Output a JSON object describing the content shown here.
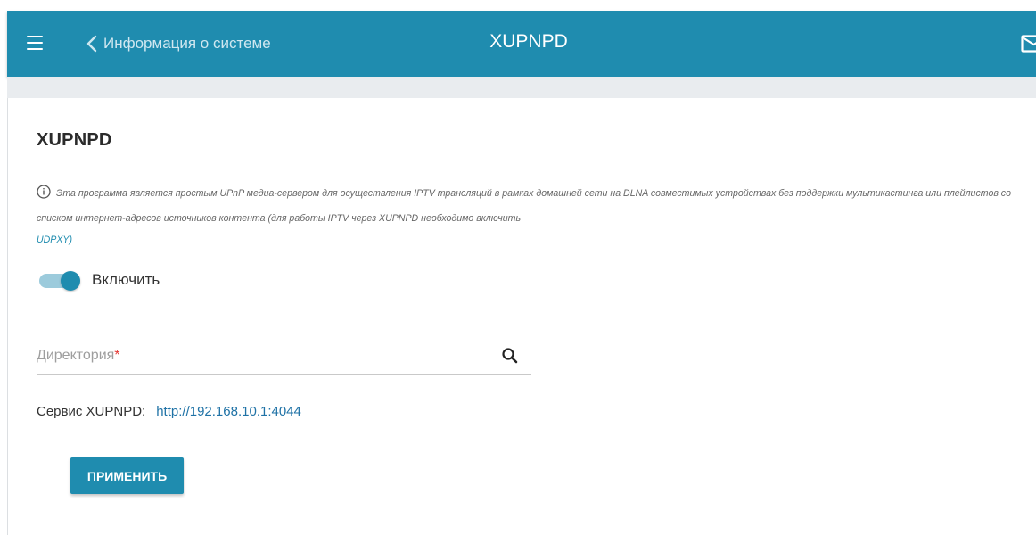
{
  "header": {
    "back_label": "Информация о системе",
    "title": "XUPNPD",
    "bg_color": "#1f8caf"
  },
  "page": {
    "title": "XUPNPD",
    "info_text": "Эта программа является простым UPnP медиа-сервером для осуществления IPTV трансляций в рамках домашней сети на DLNA совместимых устройствах без поддержки мультикастинга или плейлистов со списком интернет-адресов источников контента (для работы IPTV через XUPNPD необходимо включить",
    "info_link": "UDPXY)",
    "enable_label": "Включить",
    "enable_state": true,
    "directory_placeholder": "Директория",
    "required_mark": "*",
    "service_label": "Сервис XUPNPD:",
    "service_url": "http://192.168.10.1:4044",
    "apply_label": "ПРИМЕНИТЬ"
  },
  "icons": [
    "menu-icon",
    "chevron-left-icon",
    "mail-icon",
    "info-icon",
    "search-icon"
  ]
}
